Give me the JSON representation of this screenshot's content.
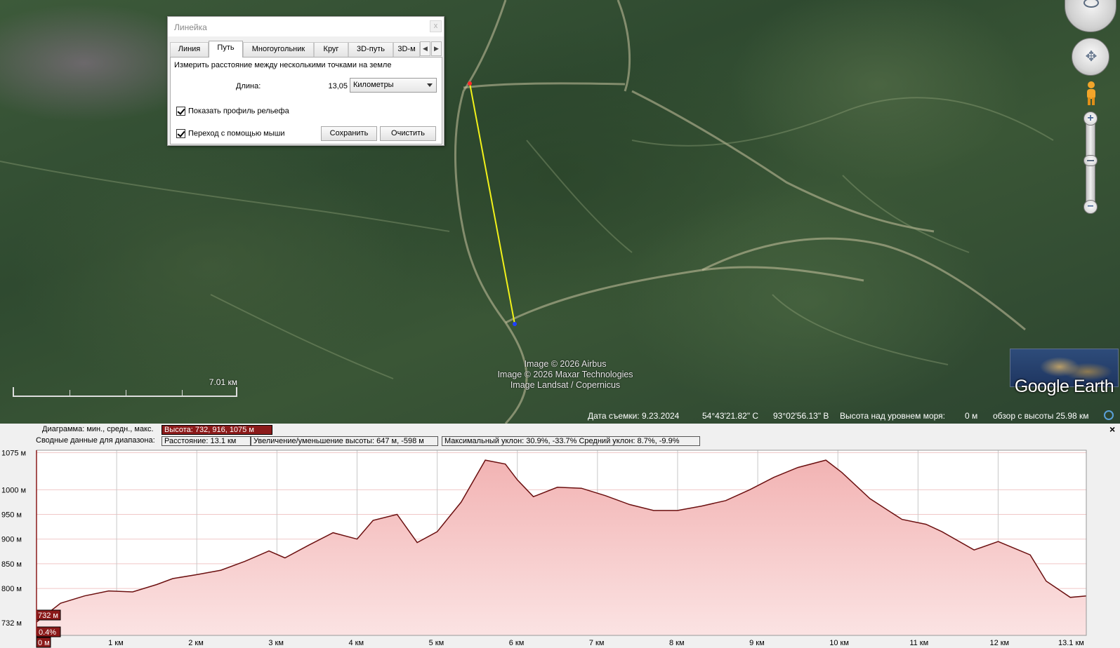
{
  "map": {
    "attribution": [
      "Image © 2026 Airbus",
      "Image © 2026 Maxar Technologies",
      "Image Landsat / Copernicus"
    ],
    "scale_label": "7.01 км",
    "logo_text": "Google Earth"
  },
  "ruler": {
    "title": "Линейка",
    "close_glyph": "x",
    "tabs": [
      "Линия",
      "Путь",
      "Многоугольник",
      "Круг",
      "3D-путь",
      "3D-м"
    ],
    "active_tab": "Путь",
    "description": "Измерить расстояние между несколькими точками на земле",
    "length_label": "Длина:",
    "length_value": "13,05",
    "unit": "Километры",
    "show_profile": "Показать профиль рельефа",
    "mouse_nav": "Переход с помощью мыши",
    "save": "Сохранить",
    "clear": "Очистить"
  },
  "status": {
    "date": "Дата съемки: 9.23.2024",
    "lat": "54°43'21.82\" С",
    "lon": "93°02'56.13\" В",
    "elev_label": "Высота над уровнем моря:",
    "elev_value": "0 м",
    "eye": "обзор с высоты  25.98 км"
  },
  "profile": {
    "row1_label": "Диаграмма: мин., средн., макс.",
    "row1_value": "Высота: 732, 916, 1075 м",
    "row2_label": "Сводные данные для диапазона:",
    "row2_distance": "Расстояние: 13.1 км",
    "row2_gain": "Увеличение/уменьшение высоты: 647 м, -598 м",
    "row2_slope": "Максимальный уклон: 30.9%, -33.7% Средний уклон: 8.7%, -9.9%",
    "close": "×"
  },
  "chart_data": {
    "type": "area",
    "ylim": [
      705,
      1080
    ],
    "xlim": [
      0,
      13.1
    ],
    "y_ticks": [
      {
        "value": 1075,
        "label": "1075 м"
      },
      {
        "value": 1000,
        "label": "1000 м"
      },
      {
        "value": 950,
        "label": "950 м"
      },
      {
        "value": 900,
        "label": "900 м"
      },
      {
        "value": 850,
        "label": "850 м"
      },
      {
        "value": 800,
        "label": "800 м"
      },
      {
        "value": 732,
        "label": "732 м"
      }
    ],
    "x_ticks": [
      {
        "value": 0,
        "label": "0 м"
      },
      {
        "value": 1,
        "label": "1 км"
      },
      {
        "value": 2,
        "label": "2 км"
      },
      {
        "value": 3,
        "label": "3 км"
      },
      {
        "value": 4,
        "label": "4 км"
      },
      {
        "value": 5,
        "label": "5 км"
      },
      {
        "value": 6,
        "label": "6 км"
      },
      {
        "value": 7,
        "label": "7 км"
      },
      {
        "value": 8,
        "label": "8 км"
      },
      {
        "value": 9,
        "label": "9 км"
      },
      {
        "value": 10,
        "label": "10 км"
      },
      {
        "value": 11,
        "label": "11 км"
      },
      {
        "value": 12,
        "label": "12 км"
      },
      {
        "value": 13.1,
        "label": "13.1 км"
      }
    ],
    "cursor_elevation_label": "732 м",
    "cursor_slope_label": "0.4%",
    "x": [
      0,
      0.3,
      0.6,
      0.9,
      1.2,
      1.5,
      1.7,
      2.0,
      2.3,
      2.6,
      2.9,
      3.1,
      3.4,
      3.7,
      4.0,
      4.2,
      4.5,
      4.75,
      5.0,
      5.3,
      5.6,
      5.85,
      6.0,
      6.2,
      6.5,
      6.8,
      7.1,
      7.4,
      7.7,
      8.0,
      8.3,
      8.6,
      8.9,
      9.2,
      9.5,
      9.85,
      10.05,
      10.4,
      10.8,
      11.1,
      11.3,
      11.7,
      12.0,
      12.4,
      12.6,
      12.9,
      13.1
    ],
    "y": [
      732,
      770,
      785,
      795,
      793,
      808,
      820,
      828,
      837,
      855,
      876,
      862,
      888,
      913,
      900,
      938,
      950,
      893,
      915,
      975,
      1060,
      1052,
      1020,
      986,
      1005,
      1003,
      988,
      970,
      958,
      958,
      967,
      978,
      1000,
      1025,
      1045,
      1060,
      1035,
      982,
      940,
      930,
      915,
      878,
      895,
      868,
      815,
      782,
      785
    ]
  }
}
